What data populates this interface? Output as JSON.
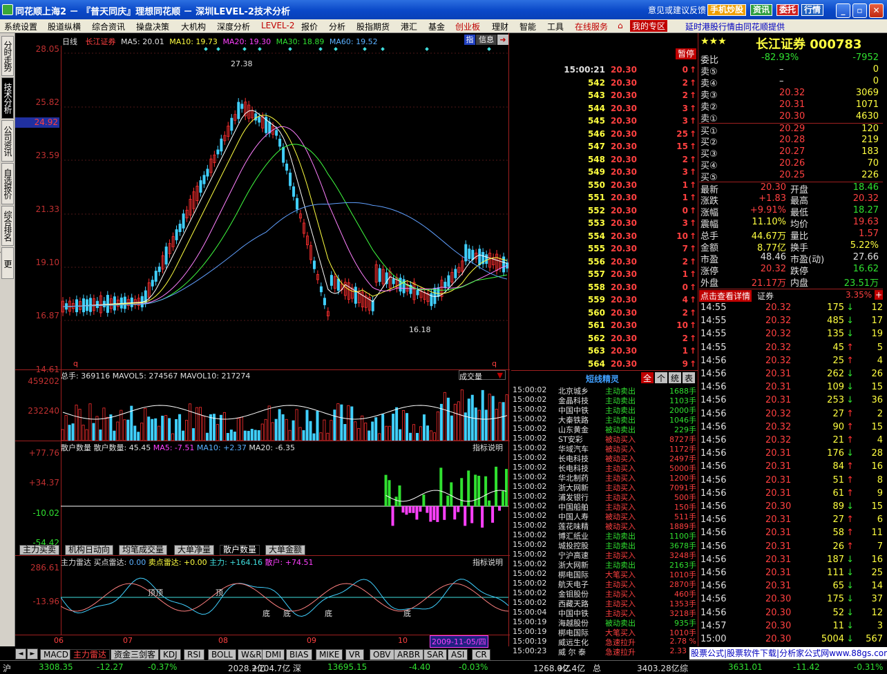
{
  "window": {
    "title": "同花顺上海2 － 『普天同庆』理想同花顺 － 深圳LEVEL-2技术分析",
    "feedback": "意见或建议反馈",
    "buttons": [
      "手机炒股",
      "资讯",
      "委托",
      "行情"
    ]
  },
  "menu": {
    "items": [
      "系统设置",
      "股道纵横",
      "综合资讯",
      "操盘决策",
      "大机构",
      "深度分析",
      "LEVEL-2",
      "报价",
      "分析",
      "股指期货",
      "港汇",
      "基金",
      "创业板",
      "理财",
      "智能",
      "工具",
      "在线服务",
      "我的专区"
    ],
    "promo": "延时港股行情由同花顺提供"
  },
  "left_tabs": [
    "分时走势",
    "技术分析",
    "公司资讯",
    "自选报价",
    "综合排名",
    "更多..."
  ],
  "kchart": {
    "period": "日线",
    "name": "长江证券",
    "ma5": "MA5: 20.01",
    "ma10": "MA10: 19.73",
    "ma20": "MA20: 19.30",
    "ma30": "MA30: 18.89",
    "ma60": "MA60: 19.52",
    "y_labels": [
      "28.05",
      "25.82",
      "23.59",
      "21.33",
      "19.10",
      "16.87",
      "14.61"
    ],
    "current_price_tag": "24.92",
    "high_mark": "27.38",
    "low_mark": "16.18",
    "info_btns": [
      "指",
      "信息"
    ],
    "q_mark": "q"
  },
  "volume": {
    "label": "总手: 369116  MAVOL5: 274567  MAVOL10: 217274",
    "y_labels": [
      "459202",
      "232240"
    ],
    "selector": "成交量"
  },
  "retail": {
    "label_a": "散户数量  散户数量: 45.45",
    "ma5": "MA5: -7.51",
    "ma10": "MA10: +2.37",
    "ma20": "MA20: -6.35",
    "explain": "指标说明",
    "y_labels": [
      "+77.76",
      "+34.37",
      "-10.02",
      "-54.42"
    ]
  },
  "indicator_tabs": [
    "主力买卖",
    "机构日动向",
    "均笔成交量",
    "大单净量",
    "散户数量",
    "大单金额"
  ],
  "radar": {
    "label_a": "主力雷达  买点雷达: ",
    "buy": "0.00",
    "sell": "卖点雷达: +0.00",
    "main": "主力: +164.16",
    "retail": "散户: +74.51",
    "explain": "指标说明",
    "y_labels": [
      "286.61",
      "-13.96"
    ],
    "top_labels": [
      "顶顶",
      "顶"
    ],
    "bottom_labels": [
      "底",
      "底",
      "底",
      "底"
    ]
  },
  "x_axis": {
    "labels": [
      "06",
      "07",
      "08",
      "09",
      "10"
    ],
    "date": "2009-11-05/四"
  },
  "bottom_tabs": [
    "MACD",
    "主力雷达",
    "资金三剑客",
    "KDJ",
    "RSI",
    "BOLL",
    "W&R",
    "DMI",
    "BIAS",
    "MIKE",
    "VR",
    "OBV",
    "ARBR",
    "SAR",
    "ASI",
    "CR"
  ],
  "ticks": {
    "pause": "暂停",
    "rows": [
      {
        "t": "15:00:21",
        "p": "20.30",
        "v": "0",
        "d": "up"
      },
      {
        "t": "542",
        "p": "20.30",
        "v": "2",
        "d": "up"
      },
      {
        "t": "543",
        "p": "20.30",
        "v": "2",
        "d": "up"
      },
      {
        "t": "544",
        "p": "20.30",
        "v": "3",
        "d": "up"
      },
      {
        "t": "545",
        "p": "20.30",
        "v": "3",
        "d": "up"
      },
      {
        "t": "546",
        "p": "20.30",
        "v": "25",
        "d": "up"
      },
      {
        "t": "547",
        "p": "20.30",
        "v": "15",
        "d": "up"
      },
      {
        "t": "548",
        "p": "20.30",
        "v": "2",
        "d": "up"
      },
      {
        "t": "549",
        "p": "20.30",
        "v": "3",
        "d": "up"
      },
      {
        "t": "550",
        "p": "20.30",
        "v": "1",
        "d": "up"
      },
      {
        "t": "551",
        "p": "20.30",
        "v": "1",
        "d": "up"
      },
      {
        "t": "552",
        "p": "20.30",
        "v": "0",
        "d": "up"
      },
      {
        "t": "553",
        "p": "20.30",
        "v": "3",
        "d": "up"
      },
      {
        "t": "554",
        "p": "20.30",
        "v": "10",
        "d": "up"
      },
      {
        "t": "555",
        "p": "20.30",
        "v": "7",
        "d": "up"
      },
      {
        "t": "556",
        "p": "20.30",
        "v": "2",
        "d": "up"
      },
      {
        "t": "557",
        "p": "20.30",
        "v": "1",
        "d": "up"
      },
      {
        "t": "558",
        "p": "20.30",
        "v": "0",
        "d": "up"
      },
      {
        "t": "559",
        "p": "20.30",
        "v": "4",
        "d": "up"
      },
      {
        "t": "560",
        "p": "20.30",
        "v": "2",
        "d": "up"
      },
      {
        "t": "561",
        "p": "20.30",
        "v": "10",
        "d": "up"
      },
      {
        "t": "562",
        "p": "20.30",
        "v": "2",
        "d": "up"
      },
      {
        "t": "563",
        "p": "20.30",
        "v": "1",
        "d": "up"
      },
      {
        "t": "564",
        "p": "20.30",
        "v": "9",
        "d": "up"
      }
    ]
  },
  "sprite": {
    "title": "短线精灵",
    "btns": [
      "全",
      "个",
      "统",
      "表"
    ],
    "rows": [
      [
        "15:00:02",
        "北京城乡",
        "主动卖出",
        "1688手",
        "g"
      ],
      [
        "15:00:02",
        "金晶科技",
        "主动卖出",
        "1103手",
        "g"
      ],
      [
        "15:00:02",
        "中国中铁",
        "主动卖出",
        "2000手",
        "g"
      ],
      [
        "15:00:02",
        "大秦铁路",
        "主动卖出",
        "1046手",
        "g"
      ],
      [
        "15:00:02",
        "山东黄金",
        "被动卖出",
        "229手",
        "g"
      ],
      [
        "15:00:02",
        "ST安彩",
        "被动买入",
        "8727手",
        "r"
      ],
      [
        "15:00:02",
        "华域汽车",
        "被动买入",
        "1172手",
        "r"
      ],
      [
        "15:00:02",
        "长电科技",
        "被动买入",
        "2497手",
        "r"
      ],
      [
        "15:00:02",
        "长电科技",
        "主动买入",
        "5000手",
        "r"
      ],
      [
        "15:00:02",
        "华北制药",
        "主动买入",
        "1200手",
        "r"
      ],
      [
        "15:00:02",
        "浙大网新",
        "主动买入",
        "7091手",
        "r"
      ],
      [
        "15:00:02",
        "浦发银行",
        "主动买入",
        "500手",
        "r"
      ],
      [
        "15:00:02",
        "中国船舶",
        "主动买入",
        "150手",
        "r"
      ],
      [
        "15:00:02",
        "中国人寿",
        "被动买入",
        "511手",
        "r"
      ],
      [
        "15:00:02",
        "莲花味精",
        "被动买入",
        "1889手",
        "r"
      ],
      [
        "15:00:02",
        "博汇纸业",
        "主动卖出",
        "1100手",
        "g"
      ],
      [
        "15:00:02",
        "城投控股",
        "主动卖出",
        "3678手",
        "g"
      ],
      [
        "15:00:02",
        "宁沪高速",
        "主动买入",
        "3248手",
        "r"
      ],
      [
        "15:00:02",
        "浙大网新",
        "主动卖出",
        "2163手",
        "g"
      ],
      [
        "15:00:02",
        "梆电国际",
        "大笔买入",
        "1010手",
        "r"
      ],
      [
        "15:00:02",
        "航天电子",
        "主动买入",
        "2870手",
        "r"
      ],
      [
        "15:00:02",
        "金钼股份",
        "主动买入",
        "460手",
        "r"
      ],
      [
        "15:00:02",
        "西藏天路",
        "主动买入",
        "1353手",
        "r"
      ],
      [
        "15:00:04",
        "中国中铁",
        "主动买入",
        "3218手",
        "r"
      ],
      [
        "15:00:19",
        "海越股份",
        "被动卖出",
        "935手",
        "g"
      ],
      [
        "15:00:19",
        "梆电国际",
        "大笔买入",
        "1010手",
        "r"
      ],
      [
        "15:00:19",
        "威远生化",
        "急速拉升",
        "2.78 %",
        "r"
      ],
      [
        "15:00:23",
        "威 尔 泰",
        "急速拉升",
        "2.33 %",
        "r"
      ]
    ]
  },
  "quote": {
    "stars": "★★★",
    "name": "长江证券 000783",
    "webi_label": "委比",
    "webi_pct": "-82.93%",
    "webi_val": "-7952",
    "sells": [
      {
        "l": "卖⑤",
        "p": "–",
        "v": "0"
      },
      {
        "l": "卖④",
        "p": "–",
        "v": "0"
      },
      {
        "l": "卖③",
        "p": "20.32",
        "v": "3069"
      },
      {
        "l": "卖②",
        "p": "20.31",
        "v": "1071"
      },
      {
        "l": "卖①",
        "p": "20.30",
        "v": "4630"
      }
    ],
    "buys": [
      {
        "l": "买①",
        "p": "20.29",
        "v": "120"
      },
      {
        "l": "买②",
        "p": "20.28",
        "v": "219"
      },
      {
        "l": "买③",
        "p": "20.27",
        "v": "183"
      },
      {
        "l": "买④",
        "p": "20.26",
        "v": "70"
      },
      {
        "l": "买⑤",
        "p": "20.25",
        "v": "226"
      }
    ],
    "stats": [
      {
        "l1": "最新",
        "v1": "20.30",
        "c1": "red",
        "l2": "开盘",
        "v2": "18.46",
        "c2": "grn"
      },
      {
        "l1": "涨跌",
        "v1": "+1.83",
        "c1": "red",
        "l2": "最高",
        "v2": "20.32",
        "c2": "red"
      },
      {
        "l1": "涨幅",
        "v1": "+9.91%",
        "c1": "red",
        "l2": "最低",
        "v2": "18.27",
        "c2": "grn"
      },
      {
        "l1": "震幅",
        "v1": "11.10%",
        "c1": "yel",
        "l2": "均价",
        "v2": "19.63",
        "c2": "red"
      },
      {
        "l1": "总手",
        "v1": "44.67万",
        "c1": "yel",
        "l2": "量比",
        "v2": "1.57",
        "c2": "red"
      },
      {
        "l1": "金额",
        "v1": "8.77亿",
        "c1": "yel",
        "l2": "换手",
        "v2": "5.22%",
        "c2": "yel"
      },
      {
        "l1": "市盈",
        "v1": "48.46",
        "c1": "wht",
        "l2": "市盈(动)",
        "v2": "27.66",
        "c2": "wht"
      },
      {
        "l1": "涨停",
        "v1": "20.32",
        "c1": "red",
        "l2": "跌停",
        "v2": "16.62",
        "c2": "grn"
      },
      {
        "l1": "外盘",
        "v1": "21.17万",
        "c1": "red",
        "l2": "内盘",
        "v2": "23.51万",
        "c2": "grn"
      }
    ],
    "detail_btn": "点击查看详情",
    "sector": "证券",
    "sector_pct": "3.35%",
    "deals": [
      {
        "t": "14:55",
        "p": "20.32",
        "v": "175",
        "d": "down",
        "n": "12"
      },
      {
        "t": "14:55",
        "p": "20.32",
        "v": "485",
        "d": "down",
        "n": "17"
      },
      {
        "t": "14:55",
        "p": "20.32",
        "v": "135",
        "d": "down",
        "n": "19"
      },
      {
        "t": "14:55",
        "p": "20.32",
        "v": "45",
        "d": "up",
        "n": "5"
      },
      {
        "t": "14:56",
        "p": "20.32",
        "v": "25",
        "d": "up",
        "n": "4"
      },
      {
        "t": "14:56",
        "p": "20.31",
        "v": "262",
        "d": "down",
        "n": "26"
      },
      {
        "t": "14:56",
        "p": "20.31",
        "v": "109",
        "d": "down",
        "n": "15"
      },
      {
        "t": "14:56",
        "p": "20.31",
        "v": "253",
        "d": "down",
        "n": "36"
      },
      {
        "t": "14:56",
        "p": "20.32",
        "v": "27",
        "d": "up",
        "n": "2"
      },
      {
        "t": "14:56",
        "p": "20.32",
        "v": "90",
        "d": "up",
        "n": "15"
      },
      {
        "t": "14:56",
        "p": "20.32",
        "v": "21",
        "d": "up",
        "n": "4"
      },
      {
        "t": "14:56",
        "p": "20.31",
        "v": "176",
        "d": "down",
        "n": "28"
      },
      {
        "t": "14:56",
        "p": "20.31",
        "v": "84",
        "d": "up",
        "n": "16"
      },
      {
        "t": "14:56",
        "p": "20.31",
        "v": "51",
        "d": "up",
        "n": "8"
      },
      {
        "t": "14:56",
        "p": "20.31",
        "v": "61",
        "d": "up",
        "n": "9"
      },
      {
        "t": "14:56",
        "p": "20.30",
        "v": "89",
        "d": "down",
        "n": "15"
      },
      {
        "t": "14:56",
        "p": "20.31",
        "v": "27",
        "d": "up",
        "n": "6"
      },
      {
        "t": "14:56",
        "p": "20.31",
        "v": "58",
        "d": "up",
        "n": "11"
      },
      {
        "t": "14:56",
        "p": "20.31",
        "v": "26",
        "d": "up",
        "n": "7"
      },
      {
        "t": "14:56",
        "p": "20.31",
        "v": "187",
        "d": "down",
        "n": "16"
      },
      {
        "t": "14:56",
        "p": "20.31",
        "v": "111",
        "d": "down",
        "n": "25"
      },
      {
        "t": "14:56",
        "p": "20.31",
        "v": "65",
        "d": "down",
        "n": "14"
      },
      {
        "t": "14:56",
        "p": "20.30",
        "v": "175",
        "d": "down",
        "n": "37"
      },
      {
        "t": "14:56",
        "p": "20.30",
        "v": "52",
        "d": "down",
        "n": "12"
      },
      {
        "t": "14:57",
        "p": "20.30",
        "v": "11",
        "d": "down",
        "n": "3"
      },
      {
        "t": "15:00",
        "p": "20.30",
        "v": "5004",
        "d": "down",
        "n": "567"
      }
    ]
  },
  "ad": "股票公式|股票软件下载|分析家公式网www.88gs.com",
  "statusbar": {
    "sh_label": "沪",
    "sh_idx": "3308.35",
    "sh_chg": "-12.27",
    "sh_pct": "-0.37%",
    "sh_amt": "2028.2亿",
    "sh_extra": "+104.7亿",
    "sz_label": "深",
    "sz_idx": "13695.15",
    "sz_chg": "-4.40",
    "sz_pct": "-0.03%",
    "sz_amt": "1268.0亿",
    "sz_extra": "+2.4亿",
    "zong": "总",
    "other_idx": "3403.28亿",
    "chuang": "综",
    "c_idx": "3631.01",
    "c_chg": "-11.42",
    "c_pct": "-0.31%"
  },
  "colors": {
    "up": "#ff3030",
    "down": "#00e0e0",
    "ma5": "#ffffff",
    "ma10": "#ffff00",
    "ma20": "#ff80ff",
    "ma30": "#40ff40",
    "ma60": "#60a0ff"
  }
}
